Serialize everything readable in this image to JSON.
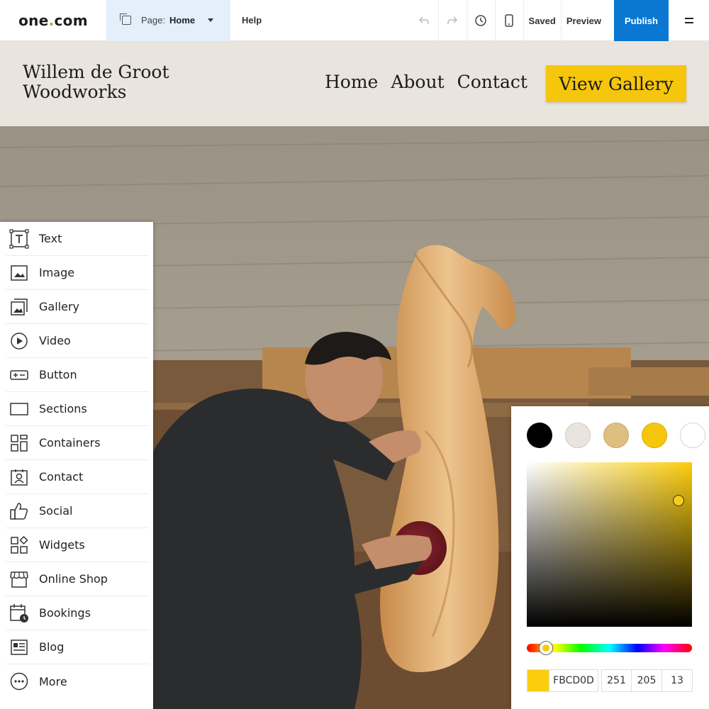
{
  "toolbar": {
    "logo_text_a": "one",
    "logo_text_dot": ".",
    "logo_text_b": "com",
    "page_label": "Page:",
    "page_value": "Home",
    "help_label": "Help",
    "saved_label": "Saved",
    "preview_label": "Preview",
    "publish_label": "Publish"
  },
  "site": {
    "title_line1": "Willem de Groot",
    "title_line2": "Woodworks",
    "nav": [
      "Home",
      "About",
      "Contact"
    ],
    "cta_label": "View Gallery"
  },
  "panel": {
    "items": [
      {
        "label": "Text",
        "icon": "text-icon"
      },
      {
        "label": "Image",
        "icon": "image-icon"
      },
      {
        "label": "Gallery",
        "icon": "gallery-icon"
      },
      {
        "label": "Video",
        "icon": "video-icon"
      },
      {
        "label": "Button",
        "icon": "button-icon"
      },
      {
        "label": "Sections",
        "icon": "sections-icon"
      },
      {
        "label": "Containers",
        "icon": "containers-icon"
      },
      {
        "label": "Contact",
        "icon": "contact-icon"
      },
      {
        "label": "Social",
        "icon": "thumbs-up-icon"
      },
      {
        "label": "Widgets",
        "icon": "widgets-icon"
      },
      {
        "label": "Online Shop",
        "icon": "shop-icon"
      },
      {
        "label": "Bookings",
        "icon": "calendar-clock-icon"
      },
      {
        "label": "Blog",
        "icon": "blog-icon"
      },
      {
        "label": "More",
        "icon": "more-icon"
      }
    ]
  },
  "picker": {
    "swatches": [
      "#000000",
      "#e9e4de",
      "#dfbf80",
      "#f6c60c",
      "#ffffff"
    ],
    "hex": "FBCD0D",
    "r": "251",
    "g": "205",
    "b": "13"
  },
  "colors": {
    "brand_blue": "#0a78d2",
    "accent_yellow": "#fbcd0d",
    "header_bg": "#e9e4de",
    "page_select_bg": "#e3f0fb"
  }
}
